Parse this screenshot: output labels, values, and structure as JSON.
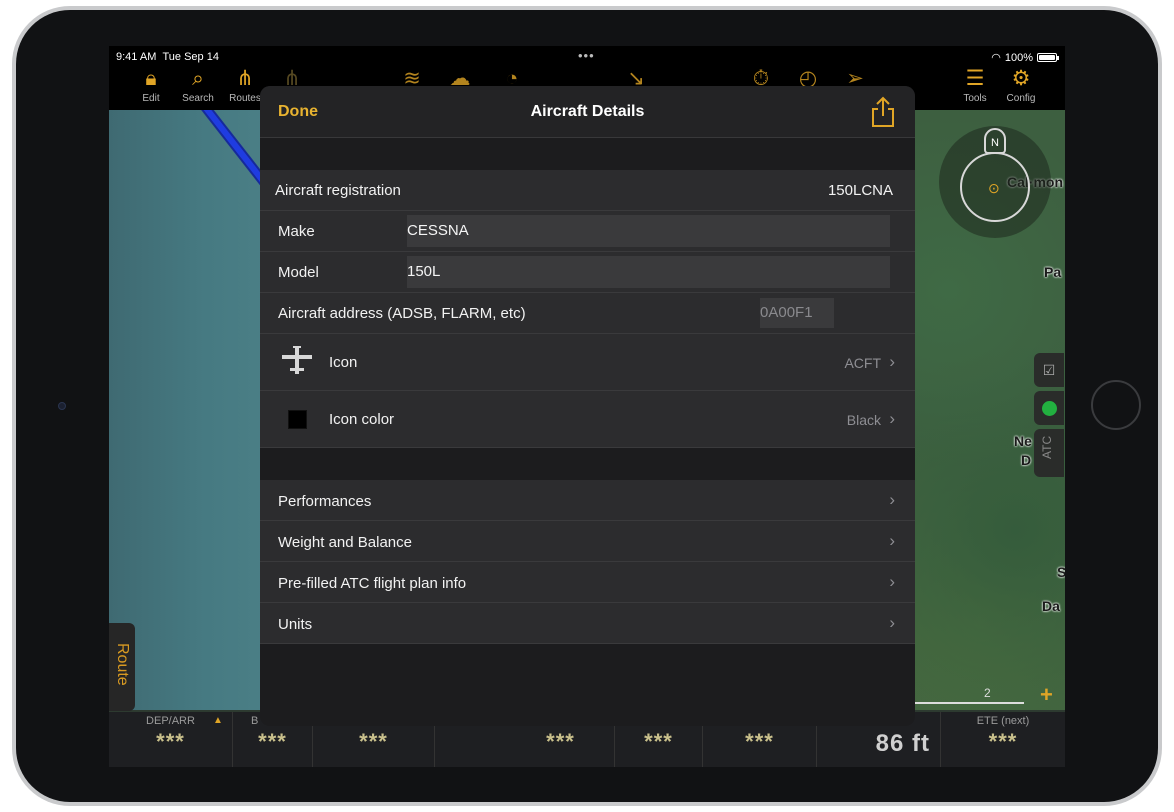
{
  "status_bar": {
    "time": "9:41 AM",
    "date": "Tue Sep 14",
    "dots": "•••",
    "battery": "100%",
    "battery_level": 1.0
  },
  "toolbar": {
    "edit": "Edit",
    "search": "Search",
    "routes": "Routes",
    "tools": "Tools",
    "config": "Config"
  },
  "map": {
    "label1": "Cal·mon",
    "label2": "Pa",
    "label3": "Ne",
    "label4": "D",
    "label5": "S",
    "label6": "Da",
    "scale_value": "2",
    "atc": "ATC",
    "route_tab": "Route",
    "compass_n": "N"
  },
  "infobar": {
    "cells": [
      {
        "label": "DEP/ARR",
        "value": "***"
      },
      {
        "label": "B",
        "value": "***"
      },
      {
        "label": "",
        "value": "***"
      },
      {
        "label": "",
        "value": "***"
      },
      {
        "label": "",
        "value": "***"
      },
      {
        "label": "",
        "value": "***"
      },
      {
        "label": "",
        "value": "86 ft"
      },
      {
        "label": "ETE (next)",
        "value": "***"
      }
    ]
  },
  "modal": {
    "done": "Done",
    "title": "Aircraft Details",
    "registration_label": "Aircraft registration",
    "registration_value": "150LCNA",
    "make_label": "Make",
    "make_value": "CESSNA",
    "model_label": "Model",
    "model_value": "150L",
    "address_label": "Aircraft address (ADSB, FLARM, etc)",
    "address_value": "0A00F1",
    "icon_label": "Icon",
    "icon_value": "ACFT",
    "icon_color_label": "Icon color",
    "icon_color_value": "Black",
    "performances": "Performances",
    "weight_balance": "Weight and Balance",
    "atc_info": "Pre-filled ATC flight plan info",
    "units": "Units"
  },
  "colors": {
    "accent": "#e0a526",
    "modal_bg": "#1c1c1e",
    "row_bg": "#2c2c2e"
  }
}
